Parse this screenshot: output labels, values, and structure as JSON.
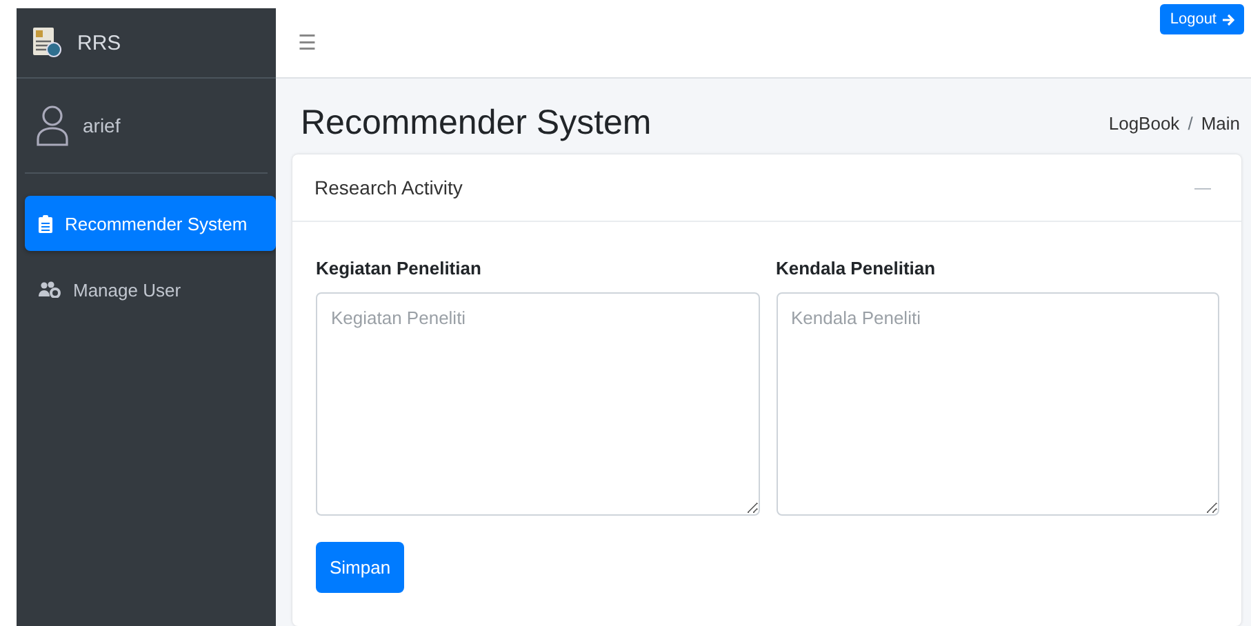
{
  "sidebar": {
    "brand": "RRS",
    "user": "arief",
    "items": [
      {
        "label": "Recommender System",
        "kind": "clipboard",
        "selected": true
      },
      {
        "label": "Manage User",
        "kind": "users",
        "selected": false
      }
    ]
  },
  "navbar": {
    "menu": "☰",
    "logout": "Logout"
  },
  "header": {
    "title": "Recommender System",
    "breadcrumb": [
      "LogBook",
      "Main"
    ],
    "breadcrumb_separator": "/"
  },
  "card": {
    "title": "Research Activity",
    "collapse": "—",
    "fields": [
      {
        "label": "Kegiatan Penelitian",
        "placeholder": "Kegiatan Peneliti"
      },
      {
        "label": "Kendala Penelitian",
        "placeholder": "Kendala Peneliti"
      }
    ],
    "button": "Simpan"
  }
}
